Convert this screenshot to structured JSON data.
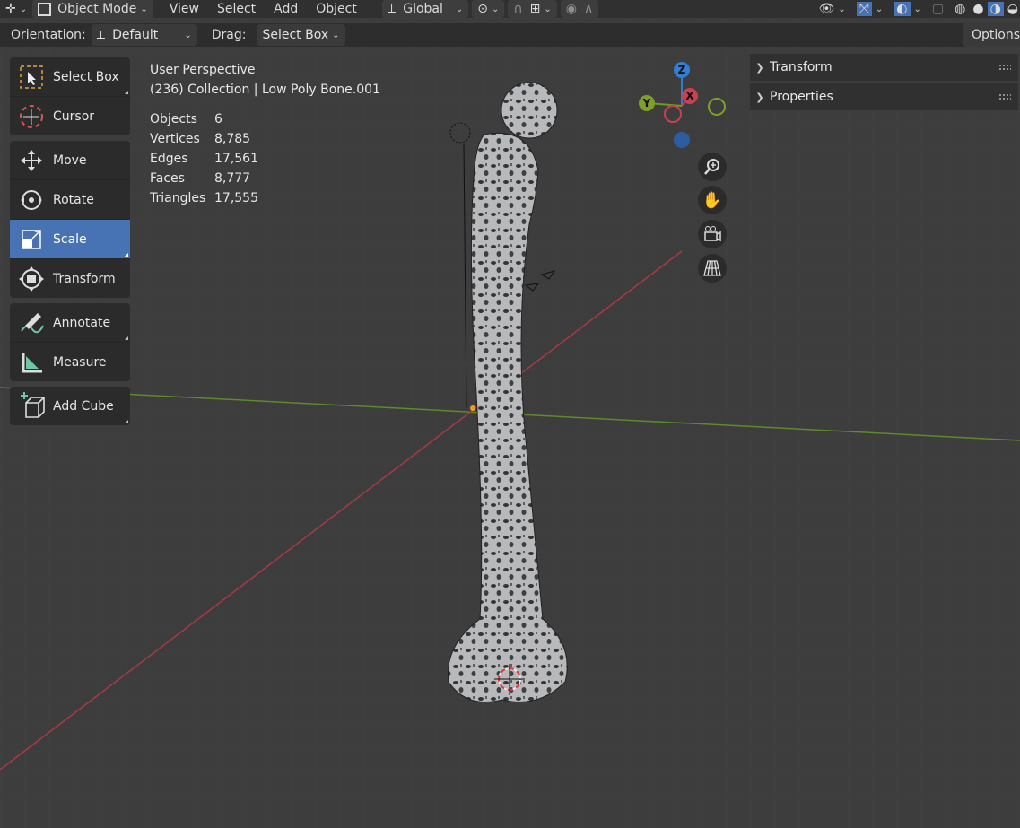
{
  "header": {
    "editor_icon": "editor-type-icon",
    "mode": "Object Mode",
    "menu": [
      "View",
      "Select",
      "Add",
      "Object"
    ],
    "transform_orientation": "Global"
  },
  "tool_settings": {
    "orientation_label": "Orientation:",
    "orientation_value": "Default",
    "drag_label": "Drag:",
    "drag_value": "Select Box",
    "options_label": "Options"
  },
  "toolbar": {
    "groups": [
      [
        {
          "label": "Select Box",
          "icon": "select-box-icon"
        },
        {
          "label": "Cursor",
          "icon": "cursor-icon"
        }
      ],
      [
        {
          "label": "Move",
          "icon": "move-icon"
        },
        {
          "label": "Rotate",
          "icon": "rotate-icon"
        },
        {
          "label": "Scale",
          "icon": "scale-icon",
          "active": true
        },
        {
          "label": "Transform",
          "icon": "transform-icon"
        }
      ],
      [
        {
          "label": "Annotate",
          "icon": "annotate-icon"
        },
        {
          "label": "Measure",
          "icon": "measure-icon"
        }
      ],
      [
        {
          "label": "Add Cube",
          "icon": "add-cube-icon"
        }
      ]
    ]
  },
  "viewport": {
    "view_name": "User Perspective",
    "collection_info": "(236) Collection | Low Poly Bone.001",
    "stats": [
      {
        "label": "Objects",
        "value": "6"
      },
      {
        "label": "Vertices",
        "value": "8,785"
      },
      {
        "label": "Edges",
        "value": "17,561"
      },
      {
        "label": "Faces",
        "value": "8,777"
      },
      {
        "label": "Triangles",
        "value": "17,555"
      }
    ]
  },
  "gizmo": {
    "z": "Z",
    "y": "Y",
    "x": "X"
  },
  "npanel": {
    "sections": [
      {
        "label": "Transform"
      },
      {
        "label": "Properties"
      }
    ]
  },
  "colors": {
    "x_axis": "#c6424f",
    "y_axis": "#6f9a28",
    "z_axis": "#2f7fd6",
    "active_tool": "#4772b3"
  }
}
